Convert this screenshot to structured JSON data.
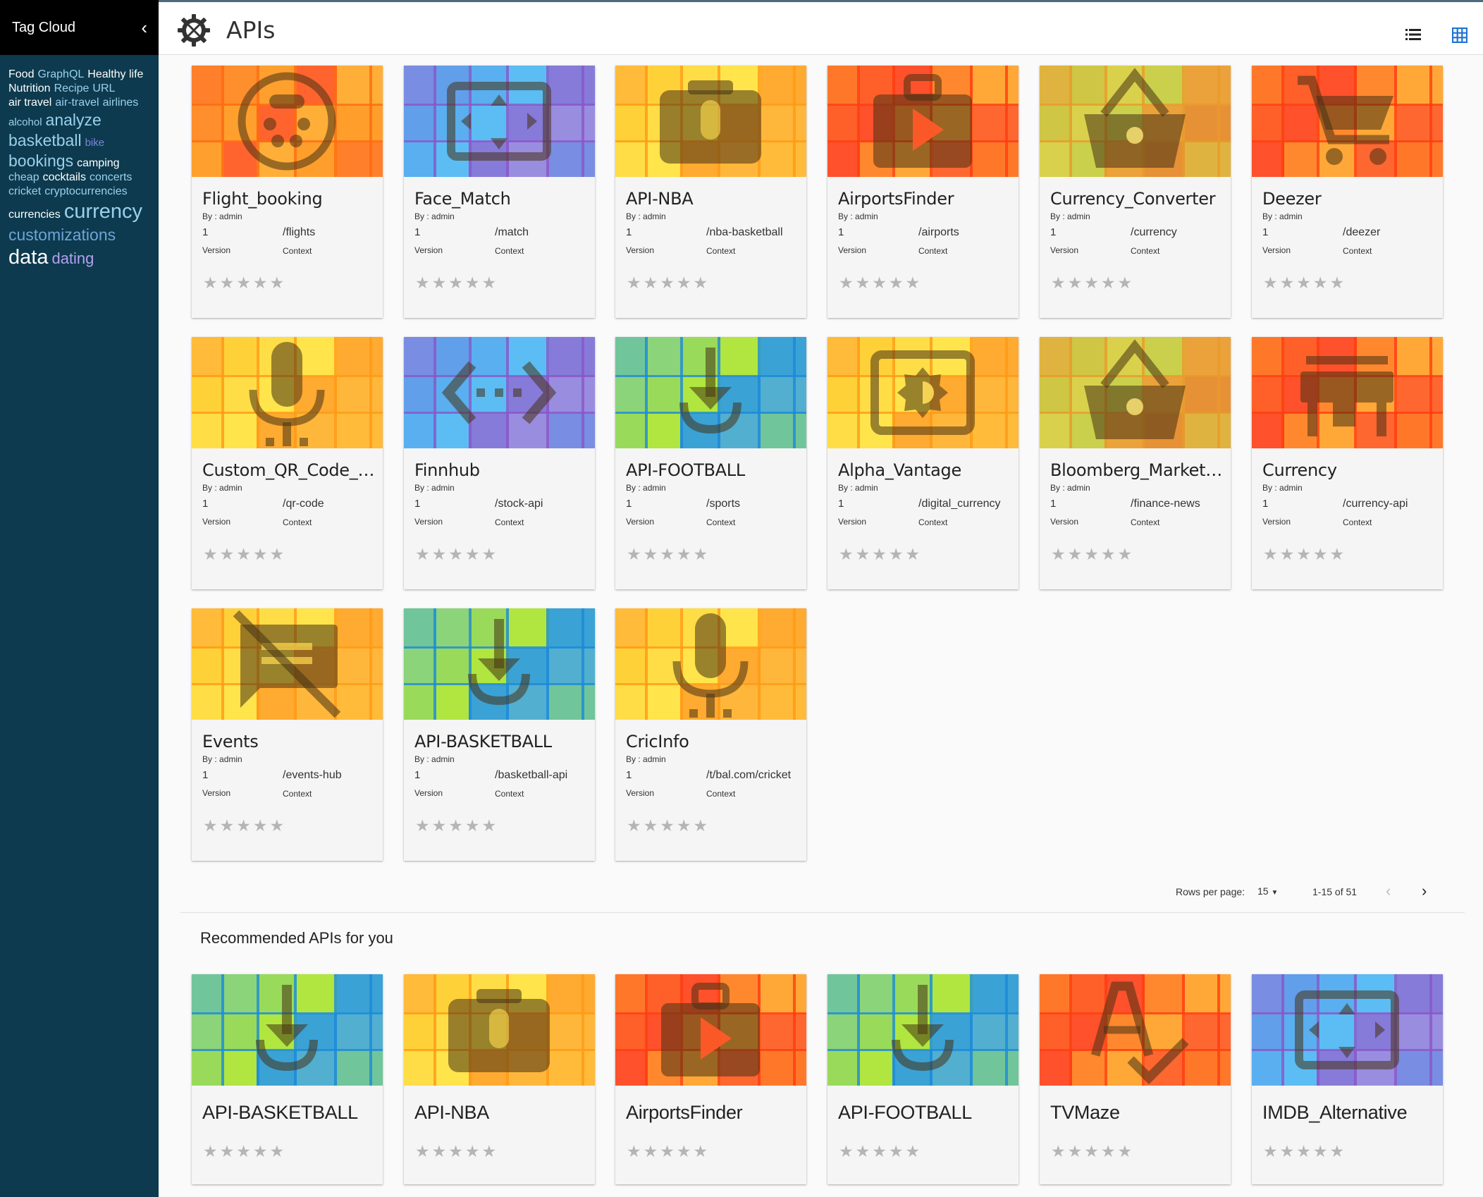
{
  "sidebar": {
    "title": "Tag Cloud",
    "collapse_icon": "chevron-left-icon",
    "tags": [
      {
        "label": "Food",
        "color": "#ffffff",
        "size": 16
      },
      {
        "label": "GraphQL",
        "color": "#9ad0ec",
        "size": 16
      },
      {
        "label": "Healthy life",
        "color": "#ffffff",
        "size": 16
      },
      {
        "label": "Nutrition",
        "color": "#ffffff",
        "size": 16
      },
      {
        "label": "Recipe",
        "color": "#9ad0ec",
        "size": 16
      },
      {
        "label": "URL",
        "color": "#9ad0ec",
        "size": 16
      },
      {
        "label": "air travel",
        "color": "#ffffff",
        "size": 16
      },
      {
        "label": "air-travel",
        "color": "#9ad0ec",
        "size": 16
      },
      {
        "label": "airlines",
        "color": "#9ad0ec",
        "size": 16
      },
      {
        "label": "alcohol",
        "color": "#9ad0ec",
        "size": 15
      },
      {
        "label": "analyze",
        "color": "#9ad0ec",
        "size": 23
      },
      {
        "label": "basketball",
        "color": "#9ad0ec",
        "size": 23
      },
      {
        "label": "bike",
        "color": "#7b86d8",
        "size": 15
      },
      {
        "label": "bookings",
        "color": "#9ad0ec",
        "size": 23
      },
      {
        "label": "camping",
        "color": "#ffffff",
        "size": 16
      },
      {
        "label": "cheap",
        "color": "#9ad0ec",
        "size": 16
      },
      {
        "label": "cocktails",
        "color": "#ffffff",
        "size": 16
      },
      {
        "label": "concerts",
        "color": "#9ad0ec",
        "size": 16
      },
      {
        "label": "cricket",
        "color": "#9ad0ec",
        "size": 16
      },
      {
        "label": "cryptocurrencies",
        "color": "#9ad0ec",
        "size": 16
      },
      {
        "label": "currencies",
        "color": "#ffffff",
        "size": 16
      },
      {
        "label": "currency",
        "color": "#9ad0ec",
        "size": 29
      },
      {
        "label": "customizations",
        "color": "#6ea4d8",
        "size": 23
      },
      {
        "label": "data",
        "color": "#ffffff",
        "size": 29
      },
      {
        "label": "dating",
        "color": "#b3a1f0",
        "size": 22
      }
    ]
  },
  "header": {
    "title": "APIs",
    "logo_icon": "gear-tools-icon",
    "list_view_icon": "list-view-icon",
    "grid_view_icon": "grid-view-icon"
  },
  "labels": {
    "by_prefix": "By : ",
    "version": "Version",
    "context": "Context"
  },
  "apis": [
    {
      "name": "Flight_booking",
      "by": "admin",
      "version": "1",
      "context": "/flights",
      "icon": "dvr-icon",
      "palette": "orange"
    },
    {
      "name": "Face_Match",
      "by": "admin",
      "version": "1",
      "context": "/match",
      "icon": "fullscreen-icon",
      "palette": "blue"
    },
    {
      "name": "API-NBA",
      "by": "admin",
      "version": "1",
      "context": "/nba-basketball",
      "icon": "camera-mic-icon",
      "palette": "yellow"
    },
    {
      "name": "AirportsFinder",
      "by": "admin",
      "version": "1",
      "context": "/airports",
      "icon": "media-case-icon",
      "palette": "red"
    },
    {
      "name": "Currency_Converter",
      "by": "admin",
      "version": "1",
      "context": "/currency",
      "icon": "basket-icon",
      "palette": "olive"
    },
    {
      "name": "Deezer",
      "by": "admin",
      "version": "1",
      "context": "/deezer",
      "icon": "cart-icon",
      "palette": "red"
    },
    {
      "name": "Custom_QR_Code_wit...",
      "by": "admin",
      "version": "1",
      "context": "/qr-code",
      "icon": "microphone-icon",
      "palette": "yellow"
    },
    {
      "name": "Finnhub",
      "by": "admin",
      "version": "1",
      "context": "/stock-api",
      "icon": "code-icon",
      "palette": "blue"
    },
    {
      "name": "API-FOOTBALL",
      "by": "admin",
      "version": "1",
      "context": "/sports",
      "icon": "download-icon",
      "palette": "green"
    },
    {
      "name": "Alpha_Vantage",
      "by": "admin",
      "version": "1",
      "context": "/digital_currency",
      "icon": "brightness-icon",
      "palette": "yellow"
    },
    {
      "name": "Bloomberg_Market_a...",
      "by": "admin",
      "version": "1",
      "context": "/finance-news",
      "icon": "basket-icon",
      "palette": "olive"
    },
    {
      "name": "Currency",
      "by": "admin",
      "version": "1",
      "context": "/currency-api",
      "icon": "store-icon",
      "palette": "red"
    },
    {
      "name": "Events",
      "by": "admin",
      "version": "1",
      "context": "/events-hub",
      "icon": "comments-off-icon",
      "palette": "yellow"
    },
    {
      "name": "API-BASKETBALL",
      "by": "admin",
      "version": "1",
      "context": "/basketball-api",
      "icon": "download-icon",
      "palette": "green"
    },
    {
      "name": "CricInfo",
      "by": "admin",
      "version": "1",
      "context": "/t/bal.com/cricket",
      "icon": "microphone-icon",
      "palette": "yellow"
    }
  ],
  "pagination": {
    "rows_label": "Rows per page:",
    "rows_value": "15",
    "range": "1-15 of 51",
    "prev_icon": "chevron-left-icon",
    "next_icon": "chevron-right-icon"
  },
  "recommended": {
    "title": "Recommended APIs for you",
    "items": [
      {
        "name": "API-BASKETBALL",
        "icon": "download-icon",
        "palette": "green"
      },
      {
        "name": "API-NBA",
        "icon": "camera-mic-icon",
        "palette": "yellow"
      },
      {
        "name": "AirportsFinder",
        "icon": "media-case-icon",
        "palette": "red"
      },
      {
        "name": "API-FOOTBALL",
        "icon": "download-icon",
        "palette": "green"
      },
      {
        "name": "TVMaze",
        "icon": "spellcheck-icon",
        "palette": "red"
      },
      {
        "name": "IMDB_Alternative",
        "icon": "fullscreen-icon",
        "palette": "blue"
      }
    ]
  },
  "palettes": {
    "orange": {
      "base": "#ff9a2e",
      "cells": [
        "#ff7a2a",
        "#ff8c2b",
        "#ffa12e",
        "#ff5a2e",
        "#ffb13a",
        "#ff9f2a"
      ],
      "lines": "#ff6a10"
    },
    "blue": {
      "base": "#6f9ae8",
      "cells": [
        "#7b8ce0",
        "#5fa0ea",
        "#56b3f0",
        "#58c3f6",
        "#8b75d6",
        "#a18bdd"
      ],
      "lines": "#8a56c8"
    },
    "yellow": {
      "base": "#ffc83a",
      "cells": [
        "#ffb83a",
        "#ffd23a",
        "#ffe04a",
        "#ffe94f",
        "#ffa52f",
        "#ffb43c"
      ],
      "lines": "#ff9a15"
    },
    "red": {
      "base": "#ff6a2c",
      "cells": [
        "#ff7a2a",
        "#ff5e2a",
        "#ff4c2c",
        "#ff8d2f",
        "#ffb33a",
        "#ff6633"
      ],
      "lines": "#ff3c10"
    },
    "olive": {
      "base": "#d8b83f",
      "cells": [
        "#e0b23f",
        "#cdc845",
        "#d9d54f",
        "#c8d24f",
        "#ee9d3a",
        "#e98a35"
      ],
      "lines": "#e89a2a"
    },
    "green": {
      "base": "#7ed07a",
      "cells": [
        "#6fc3a0",
        "#8dd57a",
        "#9fdc55",
        "#b8ea35",
        "#2f9ae6",
        "#4aa9df"
      ],
      "lines": "#1b89d8"
    }
  }
}
